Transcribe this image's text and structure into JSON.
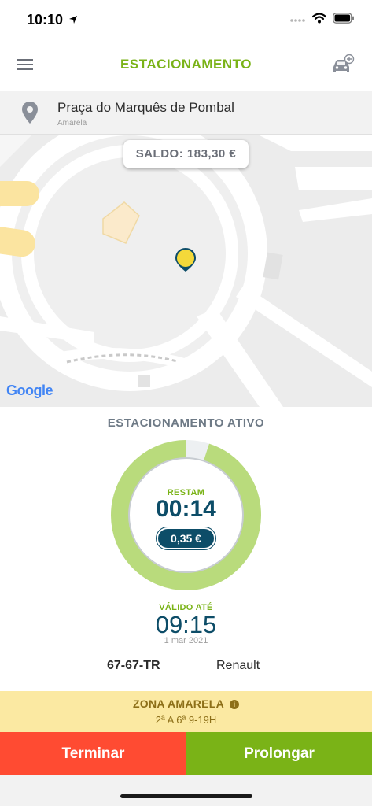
{
  "status_bar": {
    "time": "10:10"
  },
  "header": {
    "title": "ESTACIONAMENTO"
  },
  "location": {
    "name": "Praça do Marquês de Pombal",
    "zone": "Amarela"
  },
  "map": {
    "balance": "SALDO: 183,30 €",
    "attribution": "Google"
  },
  "active_parking": {
    "title": "ESTACIONAMENTO ATIVO",
    "remaining_label": "RESTAM",
    "remaining_time": "00:14",
    "cost": "0,35 €",
    "remaining_fraction": 0.95,
    "valid_label": "VÁLIDO ATÉ",
    "valid_time": "09:15",
    "valid_date": "1 mar 2021"
  },
  "vehicle": {
    "plate": "67-67-TR",
    "brand": "Renault"
  },
  "zone_info": {
    "title": "ZONA AMARELA",
    "info_glyph": "i",
    "hours": "2ª A 6ª 9-19H"
  },
  "actions": {
    "end_label": "Terminar",
    "extend_label": "Prolongar"
  },
  "colors": {
    "accent_green": "#7ab317",
    "navy": "#0d4d68",
    "end_red": "#ff4b32",
    "zone_yellow": "#fbe9a2",
    "ring_green": "#b9db7c"
  }
}
